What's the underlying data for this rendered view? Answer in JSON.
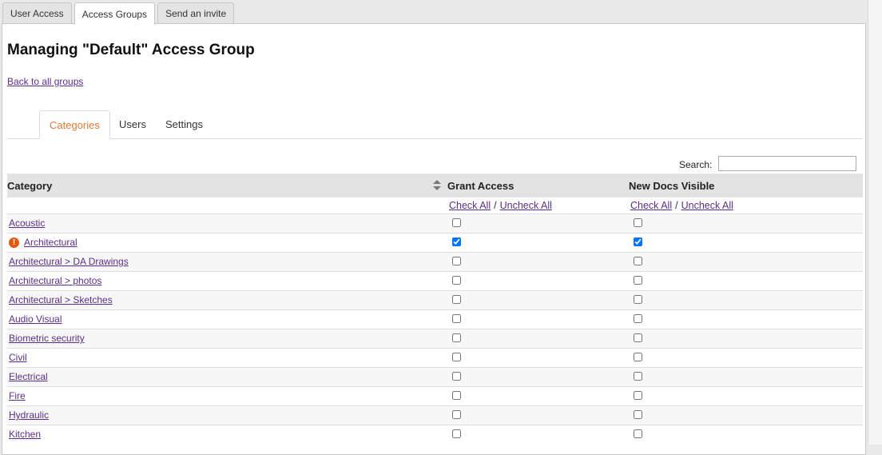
{
  "outer_tabs": [
    {
      "label": "User Access"
    },
    {
      "label": "Access Groups",
      "active": true
    },
    {
      "label": "Send an invite"
    }
  ],
  "title": "Managing \"Default\" Access Group",
  "back_link": "Back to all groups",
  "inner_tabs": [
    {
      "label": "Categories",
      "active": true
    },
    {
      "label": "Users"
    },
    {
      "label": "Settings"
    }
  ],
  "search": {
    "label": "Search:",
    "value": "",
    "placeholder": ""
  },
  "table": {
    "columns": [
      "Category",
      "Grant Access",
      "New Docs Visible"
    ],
    "check_all": "Check All",
    "separator": "/",
    "uncheck_all": "Uncheck All",
    "rows": [
      {
        "category": "Acoustic",
        "grant": false,
        "visible": false,
        "warning": false
      },
      {
        "category": "Architectural",
        "grant": true,
        "visible": true,
        "warning": true
      },
      {
        "category": "Architectural > DA Drawings",
        "grant": false,
        "visible": false,
        "warning": false
      },
      {
        "category": "Architectural > photos",
        "grant": false,
        "visible": false,
        "warning": false
      },
      {
        "category": "Architectural > Sketches",
        "grant": false,
        "visible": false,
        "warning": false
      },
      {
        "category": "Audio Visual",
        "grant": false,
        "visible": false,
        "warning": false
      },
      {
        "category": "Biometric security",
        "grant": false,
        "visible": false,
        "warning": false
      },
      {
        "category": "Civil",
        "grant": false,
        "visible": false,
        "warning": false
      },
      {
        "category": "Electrical",
        "grant": false,
        "visible": false,
        "warning": false
      },
      {
        "category": "Fire",
        "grant": false,
        "visible": false,
        "warning": false
      },
      {
        "category": "Hydraulic",
        "grant": false,
        "visible": false,
        "warning": false
      },
      {
        "category": "Kitchen",
        "grant": false,
        "visible": false,
        "warning": false
      }
    ]
  },
  "colors": {
    "link": "#5b2e8a",
    "active_tab": "#e07b39",
    "warning": "#e05a12"
  }
}
